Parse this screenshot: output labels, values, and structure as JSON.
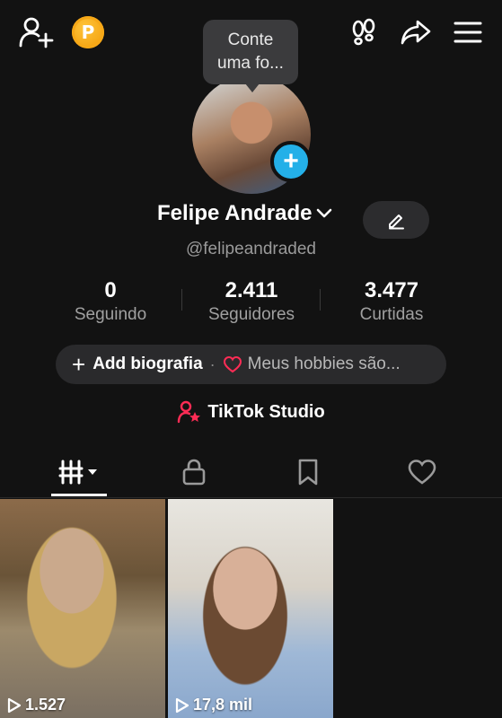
{
  "tooltip": {
    "line1": "Conte",
    "line2": "uma fo..."
  },
  "profile": {
    "name": "Felipe Andrade",
    "username": "@felipeandraded",
    "coin_letter": "P"
  },
  "stats": [
    {
      "value": "0",
      "label": "Seguindo"
    },
    {
      "value": "2.411",
      "label": "Seguidores"
    },
    {
      "value": "3.477",
      "label": "Curtidas"
    }
  ],
  "bio": {
    "add_label": "Add biografia",
    "separator": "·",
    "hobby_label": "Meus hobbies são..."
  },
  "studio": {
    "label": "TikTok Studio"
  },
  "videos": [
    {
      "views": "1.527"
    },
    {
      "views": "17,8 mil"
    }
  ],
  "colors": {
    "background": "#121212",
    "accent_blue": "#24b0e8",
    "accent_pink": "#fe2c55",
    "coin": "#f5a30c"
  },
  "icons": [
    "add-friend-icon",
    "coin-icon",
    "footprints-icon",
    "share-icon",
    "menu-icon",
    "edit-icon",
    "heart-icon",
    "studio-icon",
    "videos-tab-icon",
    "lock-icon",
    "bookmark-icon",
    "liked-heart-icon",
    "play-icon"
  ]
}
